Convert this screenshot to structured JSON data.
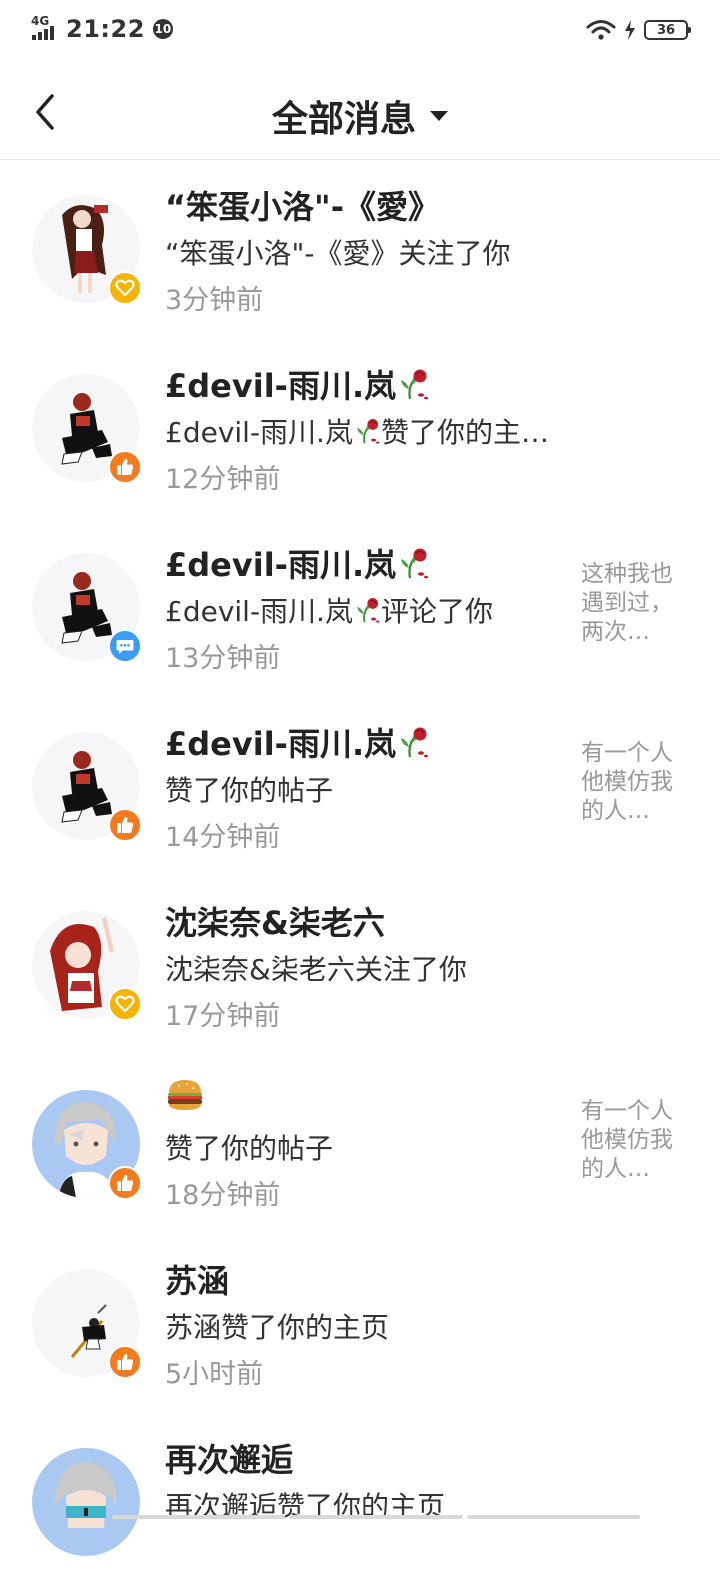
{
  "status_bar": {
    "network": "4G",
    "time": "21:22",
    "notification_count": "10",
    "battery": "36"
  },
  "header": {
    "title": "全部消息"
  },
  "messages": [
    {
      "name": "“笨蛋小洛\"-《愛》",
      "description": "“笨蛋小洛\"-《愛》关注了你",
      "time": "3分钟前",
      "type": "follow",
      "snippet": ""
    },
    {
      "name": "£devil-雨川.岚",
      "description": "£devil-雨川.岚",
      "description_suffix": "赞了你的主…",
      "time": "12分钟前",
      "type": "like",
      "snippet": ""
    },
    {
      "name": "£devil-雨川.岚",
      "description": "£devil-雨川.岚",
      "description_suffix": "评论了你",
      "time": "13分钟前",
      "type": "comment",
      "snippet": "这种我也遇到过，两次…"
    },
    {
      "name": "£devil-雨川.岚",
      "description": "赞了你的帖子",
      "time": "14分钟前",
      "type": "like",
      "snippet": "有一个人他模仿我的人…"
    },
    {
      "name": "沈柒奈&柒老六",
      "description": "沈柒奈&柒老六关注了你",
      "time": "17分钟前",
      "type": "follow",
      "snippet": ""
    },
    {
      "name": "",
      "description": "赞了你的帖子",
      "time": "18分钟前",
      "type": "like",
      "snippet": "有一个人他模仿我的人…"
    },
    {
      "name": "苏涵",
      "description": "苏涵赞了你的主页",
      "time": "5小时前",
      "type": "like",
      "snippet": ""
    },
    {
      "name": "再次邂逅",
      "description": "再次邂逅赞了你的主页",
      "time": "",
      "type": "like",
      "snippet": ""
    }
  ],
  "icons": {
    "back": "back-arrow-icon",
    "dropdown": "caret-down-icon",
    "follow_badge": "heart-icon",
    "like_badge": "thumbs-up-icon",
    "comment_badge": "speech-bubble-icon",
    "name_emoji": "wilted-rose-icon",
    "burger_emoji": "hamburger-icon"
  },
  "colors": {
    "follow_badge": "#f5b400",
    "like_badge": "#f47a20",
    "comment_badge": "#3b9bf5",
    "time_text": "#999999"
  }
}
